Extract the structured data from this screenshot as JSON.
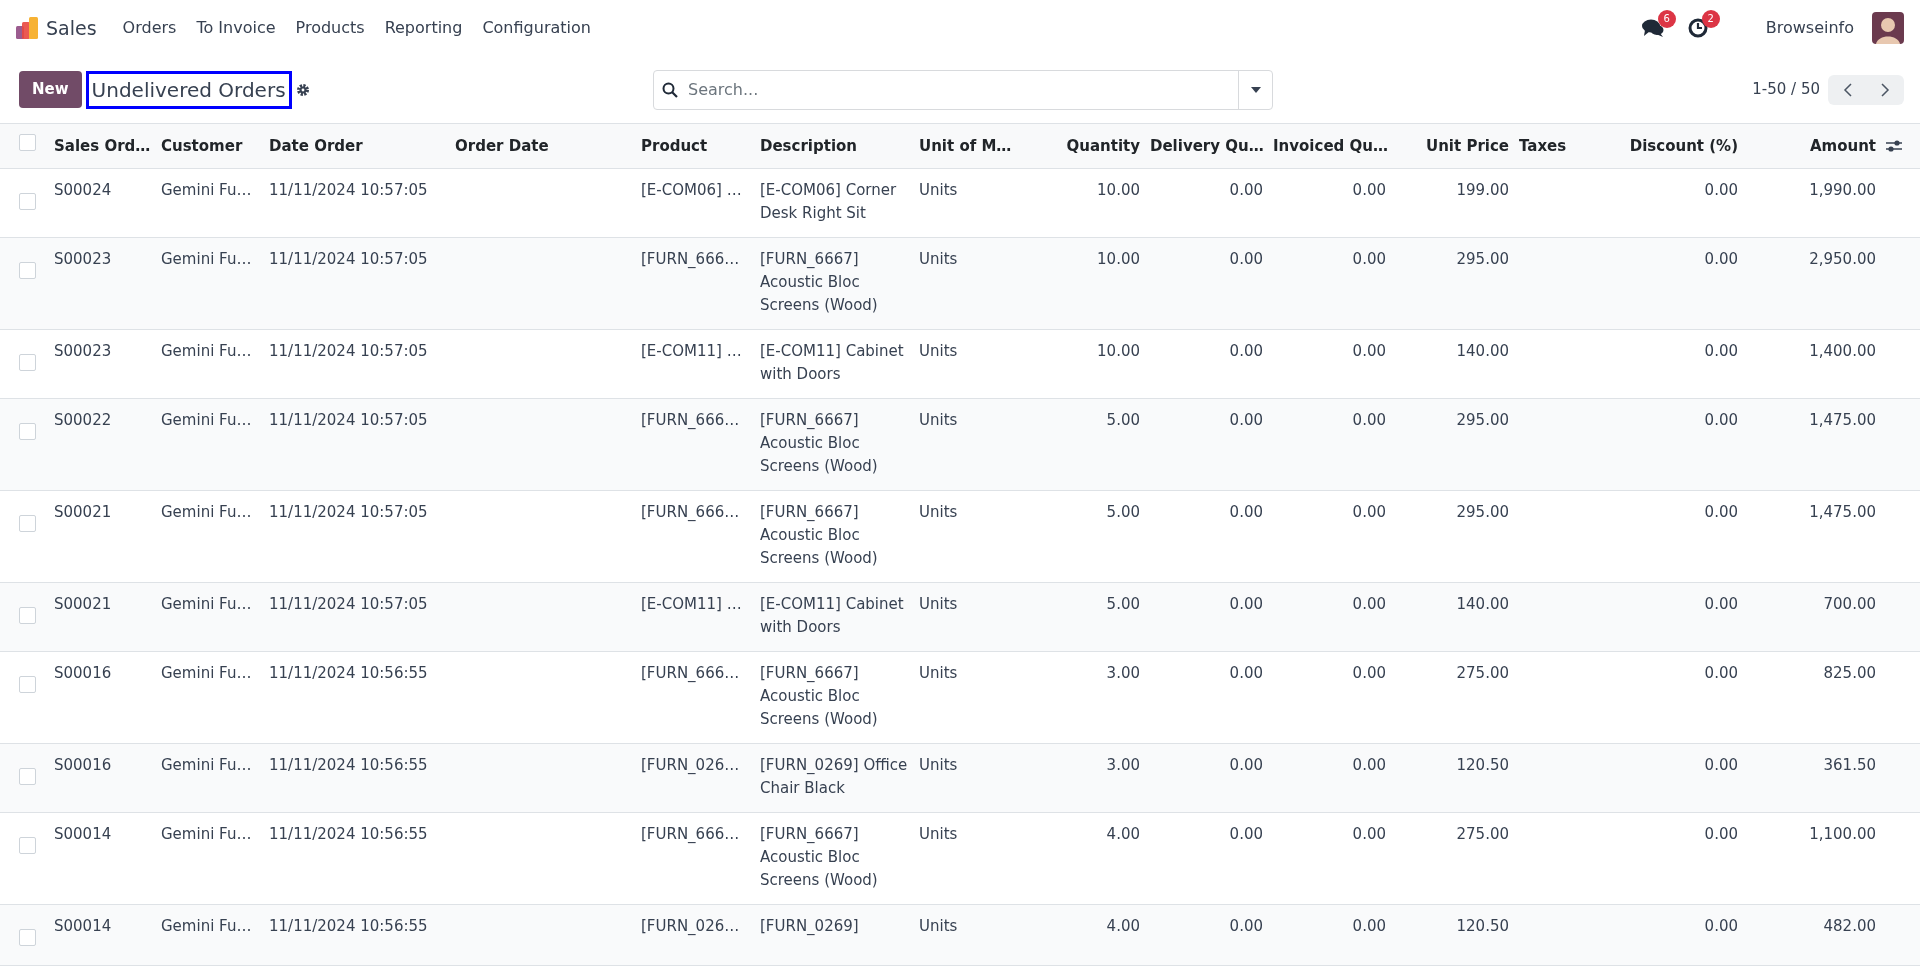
{
  "navbar": {
    "app": "Sales",
    "menu": [
      "Orders",
      "To Invoice",
      "Products",
      "Reporting",
      "Configuration"
    ],
    "messages_badge": "6",
    "activities_badge": "2",
    "user": "Browseinfo"
  },
  "control_panel": {
    "new_button": "New",
    "title": "Undelivered Orders",
    "title_highlighted": true,
    "search": {
      "placeholder": "Search..."
    },
    "pager": "1-50 / 50"
  },
  "table": {
    "select_all_checked": false,
    "columns": [
      {
        "label": "Sales Ord…",
        "kind": "text"
      },
      {
        "label": "Customer",
        "kind": "text"
      },
      {
        "label": "Date Order",
        "kind": "text"
      },
      {
        "label": "Order Date",
        "kind": "text"
      },
      {
        "label": "Product",
        "kind": "text"
      },
      {
        "label": "Description",
        "kind": "text"
      },
      {
        "label": "Unit of M…",
        "kind": "text"
      },
      {
        "label": "Quantity",
        "kind": "number"
      },
      {
        "label": "Delivery Qu…",
        "kind": "number"
      },
      {
        "label": "Invoiced Qu…",
        "kind": "number"
      },
      {
        "label": "Unit Price",
        "kind": "number"
      },
      {
        "label": "Taxes",
        "kind": "text"
      },
      {
        "label": "Discount (%)",
        "kind": "number"
      },
      {
        "label": "Amount",
        "kind": "number"
      }
    ],
    "rows": [
      {
        "checked": false,
        "cells": [
          "S00024",
          "Gemini Fu…",
          "11/11/2024 10:57:05",
          "",
          "[E-COM06] …",
          "[E-COM06] Corner Desk Right Sit",
          "Units",
          "10.00",
          "0.00",
          "0.00",
          "199.00",
          "",
          "0.00",
          "1,990.00"
        ]
      },
      {
        "checked": false,
        "cells": [
          "S00023",
          "Gemini Fu…",
          "11/11/2024 10:57:05",
          "",
          "[FURN_666…",
          "[FURN_6667] Acoustic Bloc Screens (Wood)",
          "Units",
          "10.00",
          "0.00",
          "0.00",
          "295.00",
          "",
          "0.00",
          "2,950.00"
        ]
      },
      {
        "checked": false,
        "cells": [
          "S00023",
          "Gemini Fu…",
          "11/11/2024 10:57:05",
          "",
          "[E-COM11] …",
          "[E-COM11] Cabinet with Doors",
          "Units",
          "10.00",
          "0.00",
          "0.00",
          "140.00",
          "",
          "0.00",
          "1,400.00"
        ]
      },
      {
        "checked": false,
        "cells": [
          "S00022",
          "Gemini Fu…",
          "11/11/2024 10:57:05",
          "",
          "[FURN_666…",
          "[FURN_6667] Acoustic Bloc Screens (Wood)",
          "Units",
          "5.00",
          "0.00",
          "0.00",
          "295.00",
          "",
          "0.00",
          "1,475.00"
        ]
      },
      {
        "checked": false,
        "cells": [
          "S00021",
          "Gemini Fu…",
          "11/11/2024 10:57:05",
          "",
          "[FURN_666…",
          "[FURN_6667] Acoustic Bloc Screens (Wood)",
          "Units",
          "5.00",
          "0.00",
          "0.00",
          "295.00",
          "",
          "0.00",
          "1,475.00"
        ]
      },
      {
        "checked": false,
        "cells": [
          "S00021",
          "Gemini Fu…",
          "11/11/2024 10:57:05",
          "",
          "[E-COM11] …",
          "[E-COM11] Cabinet with Doors",
          "Units",
          "5.00",
          "0.00",
          "0.00",
          "140.00",
          "",
          "0.00",
          "700.00"
        ]
      },
      {
        "checked": false,
        "cells": [
          "S00016",
          "Gemini Fu…",
          "11/11/2024 10:56:55",
          "",
          "[FURN_666…",
          "[FURN_6667] Acoustic Bloc Screens (Wood)",
          "Units",
          "3.00",
          "0.00",
          "0.00",
          "275.00",
          "",
          "0.00",
          "825.00"
        ]
      },
      {
        "checked": false,
        "cells": [
          "S00016",
          "Gemini Fu…",
          "11/11/2024 10:56:55",
          "",
          "[FURN_026…",
          "[FURN_0269] Office Chair Black",
          "Units",
          "3.00",
          "0.00",
          "0.00",
          "120.50",
          "",
          "0.00",
          "361.50"
        ]
      },
      {
        "checked": false,
        "cells": [
          "S00014",
          "Gemini Fu…",
          "11/11/2024 10:56:55",
          "",
          "[FURN_666…",
          "[FURN_6667] Acoustic Bloc Screens (Wood)",
          "Units",
          "4.00",
          "0.00",
          "0.00",
          "275.00",
          "",
          "0.00",
          "1,100.00"
        ]
      },
      {
        "checked": false,
        "cells": [
          "S00014",
          "Gemini Fu…",
          "11/11/2024 10:56:55",
          "",
          "[FURN_026…",
          "[FURN_0269]",
          "Units",
          "4.00",
          "0.00",
          "0.00",
          "120.50",
          "",
          "0.00",
          "482.00"
        ]
      }
    ]
  }
}
